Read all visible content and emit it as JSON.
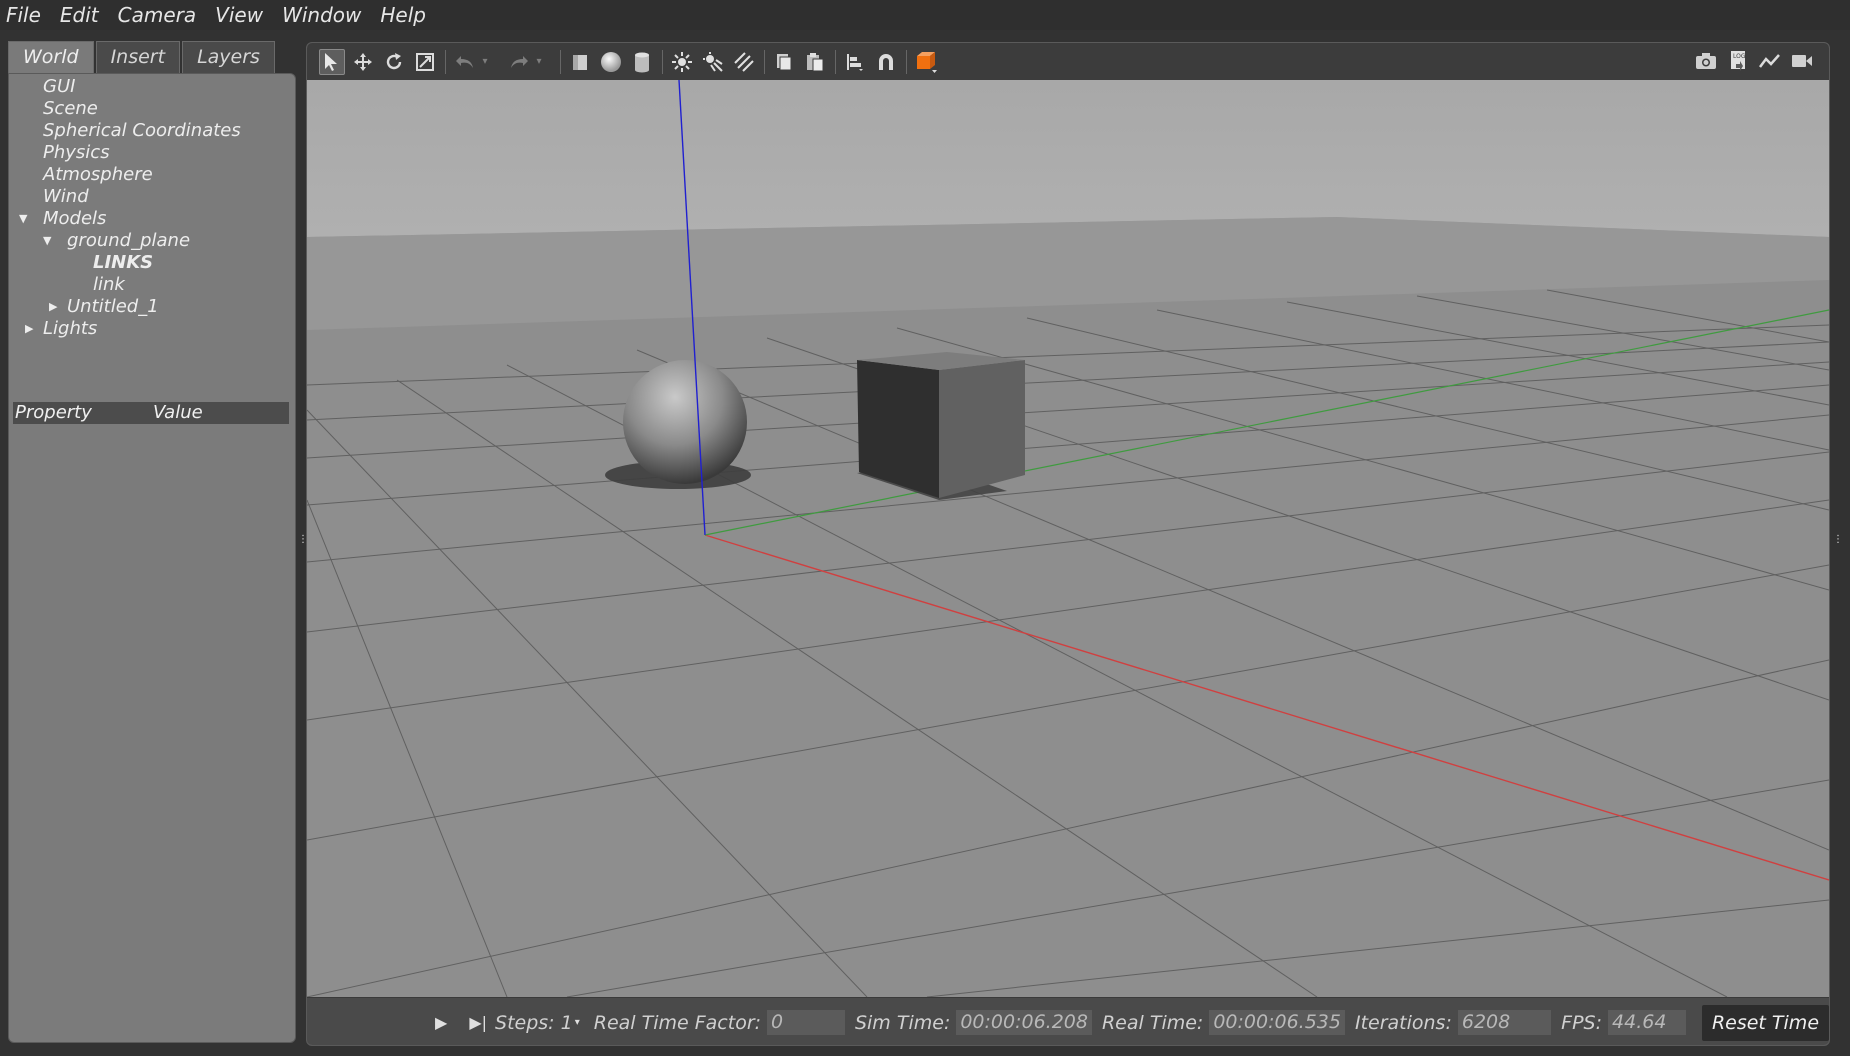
{
  "menu": [
    "File",
    "Edit",
    "Camera",
    "View",
    "Window",
    "Help"
  ],
  "tabs": [
    "World",
    "Insert",
    "Layers"
  ],
  "tree": {
    "gui": "GUI",
    "scene": "Scene",
    "spherical": "Spherical Coordinates",
    "physics": "Physics",
    "atmosphere": "Atmosphere",
    "wind": "Wind",
    "models": "Models",
    "ground_plane": "ground_plane",
    "links_header": "LINKS",
    "link": "link",
    "untitled": "Untitled_1",
    "lights": "Lights"
  },
  "properties": {
    "col1": "Property",
    "col2": "Value"
  },
  "toolbar_icons": [
    "select-icon",
    "translate-icon",
    "rotate-icon",
    "scale-icon",
    "undo-icon",
    "redo-icon",
    "box-icon",
    "sphere-icon",
    "cylinder-icon",
    "point-light-icon",
    "spot-light-icon",
    "directional-light-icon",
    "copy-icon",
    "paste-icon",
    "align-icon",
    "snap-icon",
    "view-angle-icon",
    "screenshot-icon",
    "log-icon",
    "plot-icon",
    "record-video-icon"
  ],
  "status": {
    "steps_label": "Steps: 1",
    "rtf_label": "Real Time Factor:",
    "rtf_value": "0",
    "sim_time_label": "Sim Time:",
    "sim_time_value": "00:00:06.208",
    "real_time_label": "Real Time:",
    "real_time_value": "00:00:06.535",
    "iterations_label": "Iterations:",
    "iterations_value": "6208",
    "fps_label": "FPS:",
    "fps_value": "44.64",
    "reset_label": "Reset Time"
  },
  "colors": {
    "x_axis": "#d04040",
    "y_axis": "#3f9b3f",
    "z_axis": "#2020d0",
    "orange_accent": "#f07010"
  }
}
